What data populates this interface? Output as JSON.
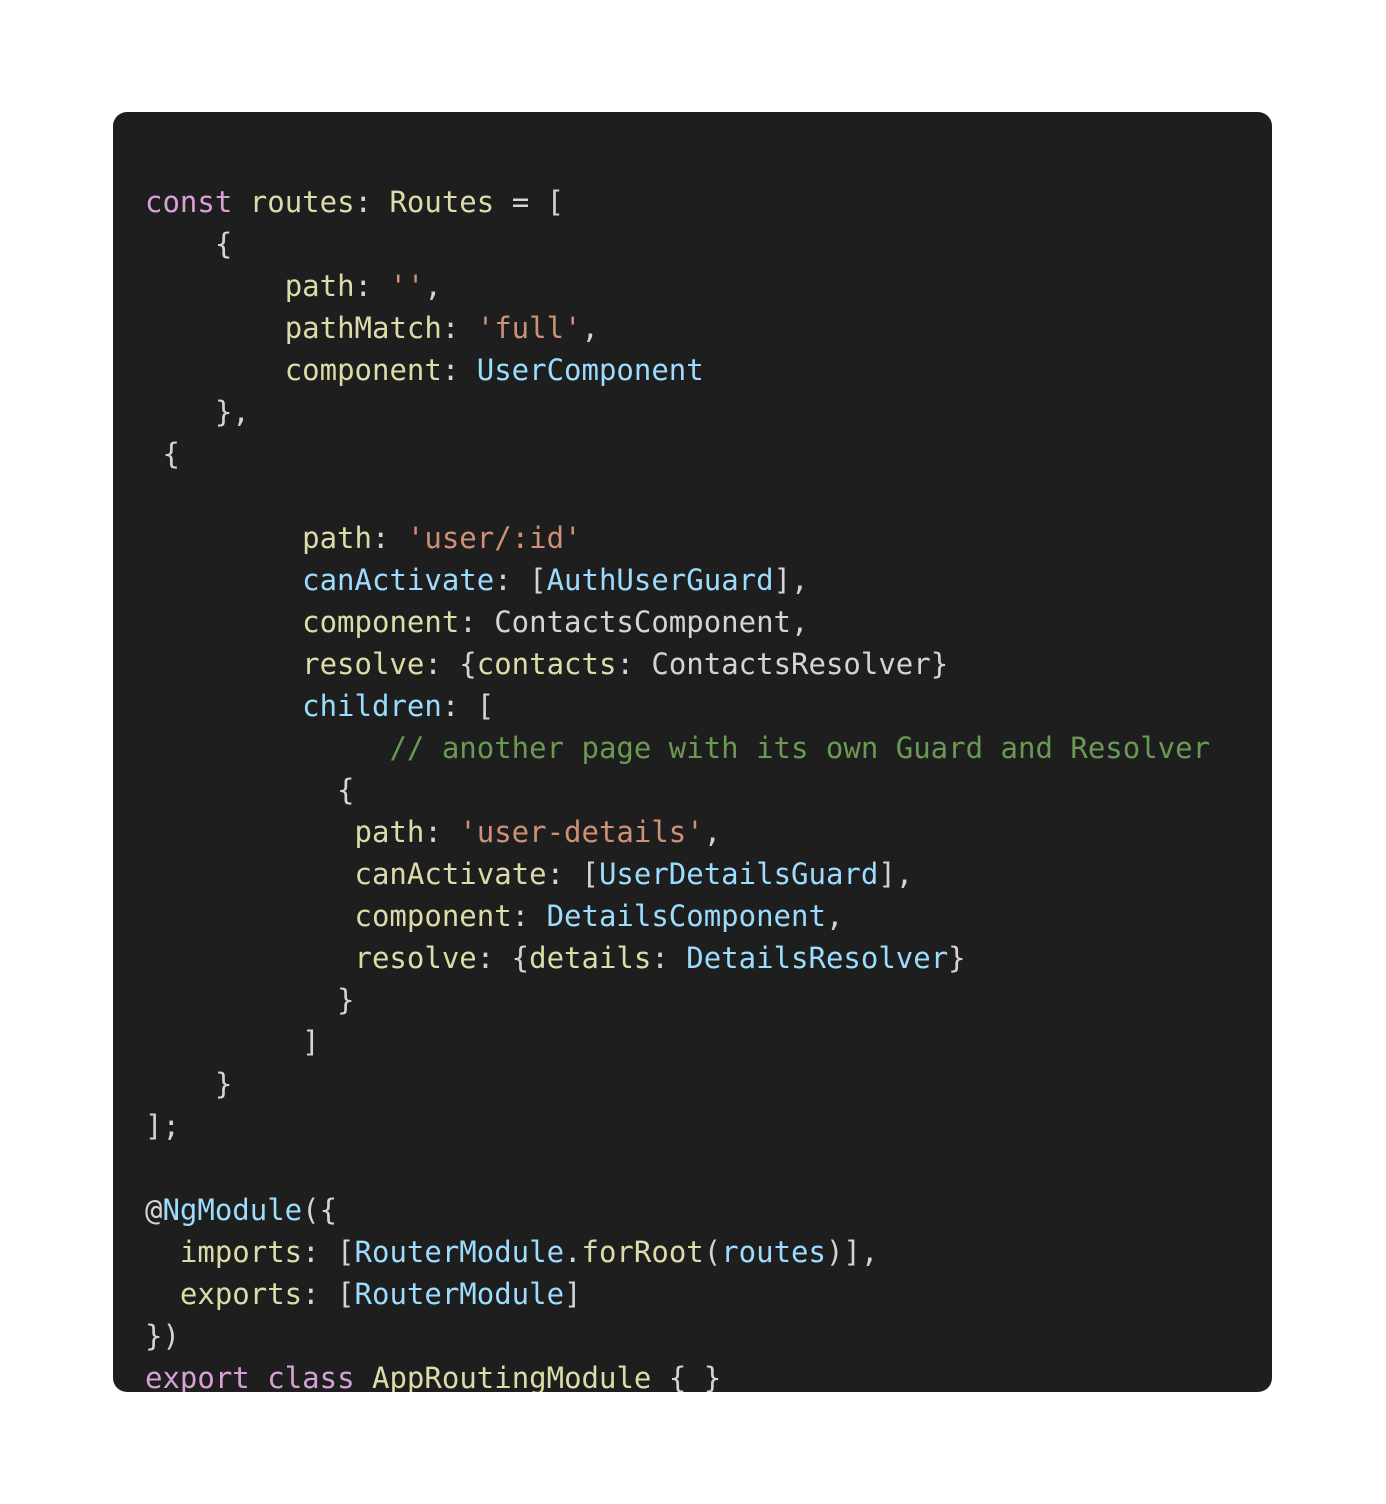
{
  "card": {
    "background_color": "#1e1e1e",
    "page_background_color": "#ffffff",
    "corner_radius_px": 14
  },
  "theme": {
    "name": "dark-plus",
    "keyword_color": "#d8a0d8",
    "property_color": "#dcdcaa",
    "string_color": "#ce9178",
    "type_color": "#9cdcfe",
    "comment_color": "#6a9955",
    "punctuation_color": "#d4d4d4",
    "background_color": "#1e1e1e"
  },
  "code": {
    "language": "typescript",
    "filename_implied": "app-routing.module.ts",
    "plain_text": "const routes: Routes = [\n    {\n        path: '',\n        pathMatch: 'full',\n        component: UserComponent\n    },\n {\n\n        path: 'user/:id'\n        canActivate: [AuthUserGuard],\n        component: ContactsComponent,\n        resolve: {contacts: ContactsResolver}\n        children: [\n            // another page with its own Guard and Resolver\n          {\n            path: 'user-details',\n            canActivate: [UserDetailsGuard],\n            component: DetailsComponent,\n            resolve: {details: DetailsResolver}\n          }\n        ]\n    }\n];\n\n@NgModule({\n  imports: [RouterModule.forRoot(routes)],\n  exports: [RouterModule]\n})\nexport class AppRoutingModule { }",
    "lines": [
      {
        "n": 1,
        "tokens": [
          {
            "t": "const",
            "c": "tok-keyword"
          },
          {
            "t": " ",
            "c": "tok-plain"
          },
          {
            "t": "routes",
            "c": "tok-property"
          },
          {
            "t": ": ",
            "c": "tok-punct"
          },
          {
            "t": "Routes",
            "c": "tok-property"
          },
          {
            "t": " = [",
            "c": "tok-punct"
          }
        ]
      },
      {
        "n": 2,
        "tokens": [
          {
            "t": "    {",
            "c": "tok-punct"
          }
        ]
      },
      {
        "n": 3,
        "tokens": [
          {
            "t": "        ",
            "c": "tok-plain"
          },
          {
            "t": "path",
            "c": "tok-property"
          },
          {
            "t": ": ",
            "c": "tok-punct"
          },
          {
            "t": "''",
            "c": "tok-string"
          },
          {
            "t": ",",
            "c": "tok-punct"
          }
        ]
      },
      {
        "n": 4,
        "tokens": [
          {
            "t": "        ",
            "c": "tok-plain"
          },
          {
            "t": "pathMatch",
            "c": "tok-property"
          },
          {
            "t": ": ",
            "c": "tok-punct"
          },
          {
            "t": "'full'",
            "c": "tok-string"
          },
          {
            "t": ",",
            "c": "tok-punct"
          }
        ]
      },
      {
        "n": 5,
        "tokens": [
          {
            "t": "        ",
            "c": "tok-plain"
          },
          {
            "t": "component",
            "c": "tok-property"
          },
          {
            "t": ": ",
            "c": "tok-punct"
          },
          {
            "t": "UserComponent",
            "c": "tok-type"
          }
        ]
      },
      {
        "n": 6,
        "tokens": [
          {
            "t": "    },",
            "c": "tok-punct"
          }
        ]
      },
      {
        "n": 7,
        "tokens": [
          {
            "t": " {",
            "c": "tok-punct"
          }
        ]
      },
      {
        "n": 8,
        "tokens": []
      },
      {
        "n": 9,
        "tokens": [
          {
            "t": "         ",
            "c": "tok-plain"
          },
          {
            "t": "path",
            "c": "tok-property"
          },
          {
            "t": ": ",
            "c": "tok-punct"
          },
          {
            "t": "'user/:id'",
            "c": "tok-string"
          }
        ]
      },
      {
        "n": 10,
        "tokens": [
          {
            "t": "         ",
            "c": "tok-plain"
          },
          {
            "t": "canActivate",
            "c": "tok-type"
          },
          {
            "t": ": [",
            "c": "tok-punct"
          },
          {
            "t": "AuthUserGuard",
            "c": "tok-type"
          },
          {
            "t": "],",
            "c": "tok-punct"
          }
        ]
      },
      {
        "n": 11,
        "tokens": [
          {
            "t": "         ",
            "c": "tok-plain"
          },
          {
            "t": "component",
            "c": "tok-property"
          },
          {
            "t": ": ",
            "c": "tok-punct"
          },
          {
            "t": "ContactsComponent",
            "c": "tok-plain"
          },
          {
            "t": ",",
            "c": "tok-punct"
          }
        ]
      },
      {
        "n": 12,
        "tokens": [
          {
            "t": "         ",
            "c": "tok-plain"
          },
          {
            "t": "resolve",
            "c": "tok-property"
          },
          {
            "t": ": {",
            "c": "tok-punct"
          },
          {
            "t": "contacts",
            "c": "tok-property"
          },
          {
            "t": ": ",
            "c": "tok-punct"
          },
          {
            "t": "ContactsResolver",
            "c": "tok-plain"
          },
          {
            "t": "}",
            "c": "tok-punct"
          }
        ]
      },
      {
        "n": 13,
        "tokens": [
          {
            "t": "         ",
            "c": "tok-plain"
          },
          {
            "t": "children",
            "c": "tok-type"
          },
          {
            "t": ": [",
            "c": "tok-punct"
          }
        ]
      },
      {
        "n": 14,
        "tokens": [
          {
            "t": "              ",
            "c": "tok-plain"
          },
          {
            "t": "// another page with its own Guard and Resolver",
            "c": "tok-comment"
          }
        ]
      },
      {
        "n": 15,
        "tokens": [
          {
            "t": "           {",
            "c": "tok-punct"
          }
        ]
      },
      {
        "n": 16,
        "tokens": [
          {
            "t": "            ",
            "c": "tok-plain"
          },
          {
            "t": "path",
            "c": "tok-property"
          },
          {
            "t": ": ",
            "c": "tok-punct"
          },
          {
            "t": "'user-details'",
            "c": "tok-string"
          },
          {
            "t": ",",
            "c": "tok-punct"
          }
        ]
      },
      {
        "n": 17,
        "tokens": [
          {
            "t": "            ",
            "c": "tok-plain"
          },
          {
            "t": "canActivate",
            "c": "tok-property"
          },
          {
            "t": ": [",
            "c": "tok-punct"
          },
          {
            "t": "UserDetailsGuard",
            "c": "tok-type"
          },
          {
            "t": "],",
            "c": "tok-punct"
          }
        ]
      },
      {
        "n": 18,
        "tokens": [
          {
            "t": "            ",
            "c": "tok-plain"
          },
          {
            "t": "component",
            "c": "tok-property"
          },
          {
            "t": ": ",
            "c": "tok-punct"
          },
          {
            "t": "DetailsComponent",
            "c": "tok-type"
          },
          {
            "t": ",",
            "c": "tok-punct"
          }
        ]
      },
      {
        "n": 19,
        "tokens": [
          {
            "t": "            ",
            "c": "tok-plain"
          },
          {
            "t": "resolve",
            "c": "tok-property"
          },
          {
            "t": ": {",
            "c": "tok-punct"
          },
          {
            "t": "details",
            "c": "tok-property"
          },
          {
            "t": ": ",
            "c": "tok-punct"
          },
          {
            "t": "DetailsResolver",
            "c": "tok-type"
          },
          {
            "t": "}",
            "c": "tok-punct"
          }
        ]
      },
      {
        "n": 20,
        "tokens": [
          {
            "t": "           }",
            "c": "tok-punct"
          }
        ]
      },
      {
        "n": 21,
        "tokens": [
          {
            "t": "         ]",
            "c": "tok-punct"
          }
        ]
      },
      {
        "n": 22,
        "tokens": [
          {
            "t": "    }",
            "c": "tok-punct"
          }
        ]
      },
      {
        "n": 23,
        "tokens": [
          {
            "t": "];",
            "c": "tok-punct"
          }
        ]
      },
      {
        "n": 24,
        "tokens": []
      },
      {
        "n": 25,
        "tokens": [
          {
            "t": "@",
            "c": "tok-plain"
          },
          {
            "t": "NgModule",
            "c": "tok-type"
          },
          {
            "t": "({",
            "c": "tok-punct"
          }
        ]
      },
      {
        "n": 26,
        "tokens": [
          {
            "t": "  ",
            "c": "tok-plain"
          },
          {
            "t": "imports",
            "c": "tok-property"
          },
          {
            "t": ": [",
            "c": "tok-punct"
          },
          {
            "t": "RouterModule",
            "c": "tok-type"
          },
          {
            "t": ".",
            "c": "tok-punct"
          },
          {
            "t": "forRoot",
            "c": "tok-func"
          },
          {
            "t": "(",
            "c": "tok-punct"
          },
          {
            "t": "routes",
            "c": "tok-type"
          },
          {
            "t": ")],",
            "c": "tok-punct"
          }
        ]
      },
      {
        "n": 27,
        "tokens": [
          {
            "t": "  ",
            "c": "tok-plain"
          },
          {
            "t": "exports",
            "c": "tok-property"
          },
          {
            "t": ": [",
            "c": "tok-punct"
          },
          {
            "t": "RouterModule",
            "c": "tok-type"
          },
          {
            "t": "]",
            "c": "tok-punct"
          }
        ]
      },
      {
        "n": 28,
        "tokens": [
          {
            "t": "})",
            "c": "tok-punct"
          }
        ]
      },
      {
        "n": 29,
        "tokens": [
          {
            "t": "export",
            "c": "tok-keyword"
          },
          {
            "t": " ",
            "c": "tok-plain"
          },
          {
            "t": "class",
            "c": "tok-keyword"
          },
          {
            "t": " ",
            "c": "tok-plain"
          },
          {
            "t": "AppRoutingModule",
            "c": "tok-property"
          },
          {
            "t": " { }",
            "c": "tok-punct"
          }
        ]
      }
    ]
  }
}
